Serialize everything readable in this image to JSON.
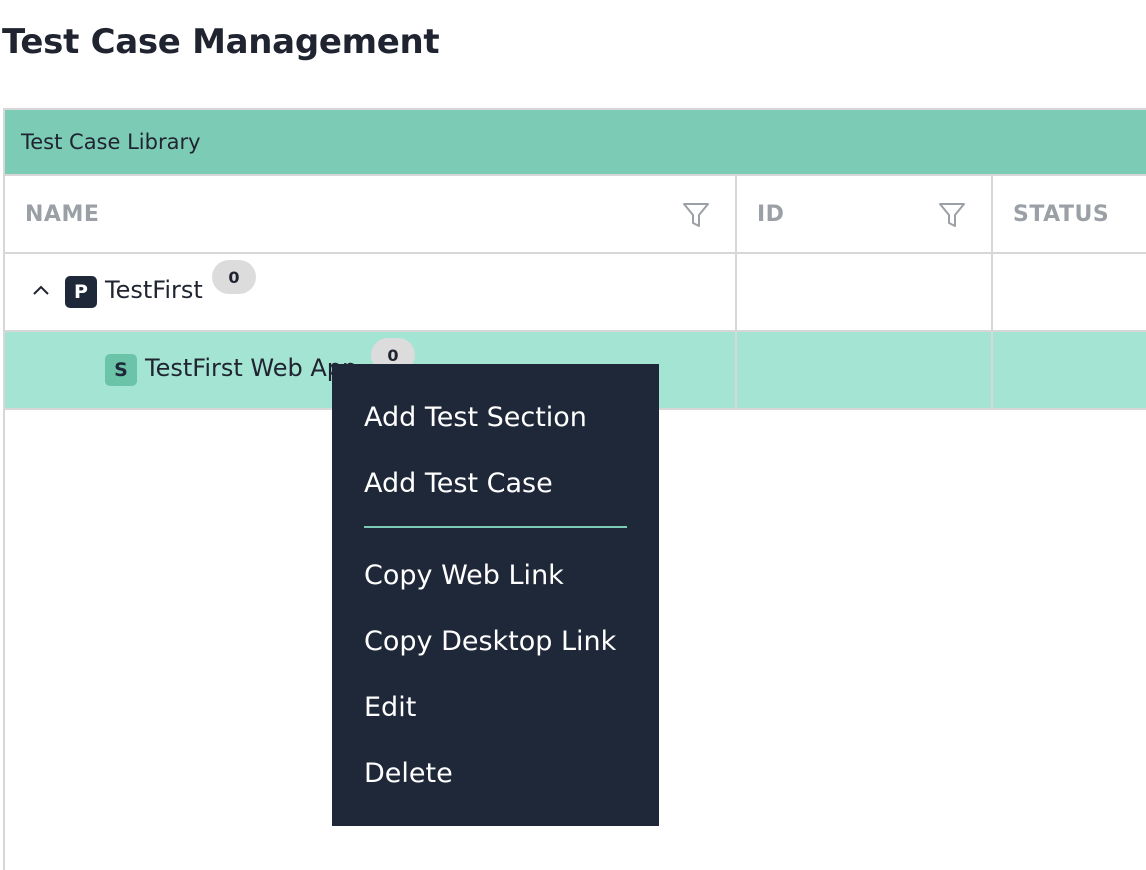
{
  "page": {
    "title": "Test Case Management"
  },
  "panel": {
    "title": "Test Case Library"
  },
  "columns": [
    {
      "label": "NAME",
      "filterable": true
    },
    {
      "label": "ID",
      "filterable": true
    },
    {
      "label": "STATUS",
      "filterable": false
    }
  ],
  "tree": {
    "items": [
      {
        "type": "P",
        "label": "TestFirst",
        "count": "0",
        "expanded": true
      },
      {
        "type": "S",
        "label": "TestFirst Web App",
        "count": "0",
        "selected": true
      }
    ]
  },
  "context_menu": {
    "items": [
      {
        "label": "Add Test Section"
      },
      {
        "label": "Add Test Case"
      },
      {
        "label": "Copy Web Link"
      },
      {
        "label": "Copy Desktop Link"
      },
      {
        "label": "Edit"
      },
      {
        "label": "Delete"
      }
    ]
  },
  "colors": {
    "header_band": "#7ccbb4",
    "selected_row": "#a4e4d3",
    "menu_bg": "#1f2838",
    "menu_divider": "#7ccbb4"
  },
  "icons": {
    "filter": "filter-funnel-icon",
    "toggle": "chevron-up-icon"
  }
}
